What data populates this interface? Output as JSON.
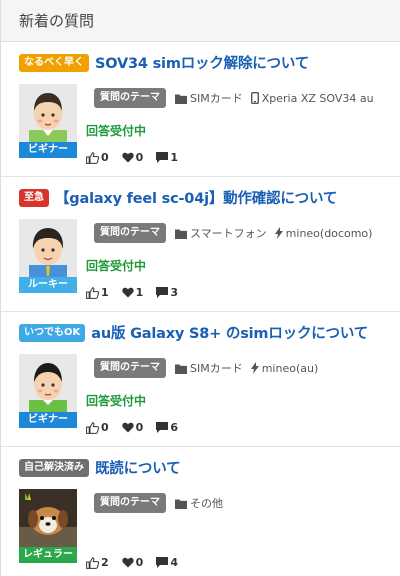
{
  "header": {
    "title": "新着の質問"
  },
  "colors": {
    "link": "#1a5fb4",
    "status": "#1e9a3a",
    "theme_tag": "#7a7a7a"
  },
  "questions": [
    {
      "badge": "なるべく早く",
      "badge_color": "#f0a000",
      "title": "SOV34 simロック解除について",
      "theme": "質問のテーマ",
      "tags": [
        {
          "icon": "folder-icon",
          "text": "SIMカード"
        },
        {
          "icon": "phone-icon",
          "text": "Xperia XZ SOV34 au"
        }
      ],
      "status": "回答受付中",
      "rank": "ビギナー",
      "rank_color": "#1e88d8",
      "likes": "0",
      "hearts": "0",
      "comments": "1"
    },
    {
      "badge": "至急",
      "badge_color": "#d9342b",
      "title": "【galaxy feel sc-04j】動作確認について",
      "theme": "質問のテーマ",
      "tags": [
        {
          "icon": "folder-icon",
          "text": "スマートフォン"
        },
        {
          "icon": "bolt-icon",
          "text": "mineo(docomo)"
        }
      ],
      "status": "回答受付中",
      "rank": "ルーキー",
      "rank_color": "#42b0e8",
      "likes": "1",
      "hearts": "1",
      "comments": "3"
    },
    {
      "badge": "いつでもOK",
      "badge_color": "#3fa9e6",
      "title": "au版 Galaxy S8+ のsimロックについて",
      "theme": "質問のテーマ",
      "tags": [
        {
          "icon": "folder-icon",
          "text": "SIMカード"
        },
        {
          "icon": "bolt-icon",
          "text": "mineo(au)"
        }
      ],
      "status": "回答受付中",
      "rank": "ビギナー",
      "rank_color": "#1e88d8",
      "likes": "0",
      "hearts": "0",
      "comments": "6"
    },
    {
      "badge": "自己解決済み",
      "badge_color": "#6f6f6f",
      "title": "既読について",
      "theme": "質問のテーマ",
      "tags": [
        {
          "icon": "folder-icon",
          "text": "その他"
        }
      ],
      "status": "",
      "rank": "レギュラー",
      "rank_color": "#2aa84a",
      "likes": "2",
      "hearts": "0",
      "comments": "4"
    }
  ]
}
